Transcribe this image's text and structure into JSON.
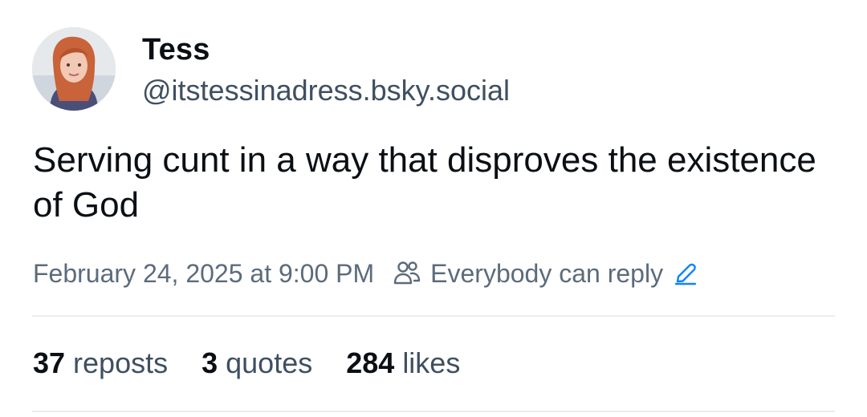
{
  "author": {
    "display_name": "Tess",
    "handle": "@itstessinadress.bsky.social",
    "avatar_icon": "user-avatar-photo"
  },
  "post": {
    "text": "Serving cunt in a way that disproves the existence of God",
    "timestamp": "February 24, 2025 at 9:00 PM",
    "reply_setting": "Everybody can reply",
    "reply_icon": "people-icon",
    "edit_icon": "pencil-icon"
  },
  "stats": {
    "reposts_count": "37",
    "reposts_label": "reposts",
    "quotes_count": "3",
    "quotes_label": "quotes",
    "likes_count": "284",
    "likes_label": "likes"
  },
  "colors": {
    "text_primary": "#0b0f14",
    "text_secondary": "#3f4f62",
    "text_meta": "#5c6b7c",
    "accent": "#1083fe",
    "divider": "#e9edf1"
  }
}
